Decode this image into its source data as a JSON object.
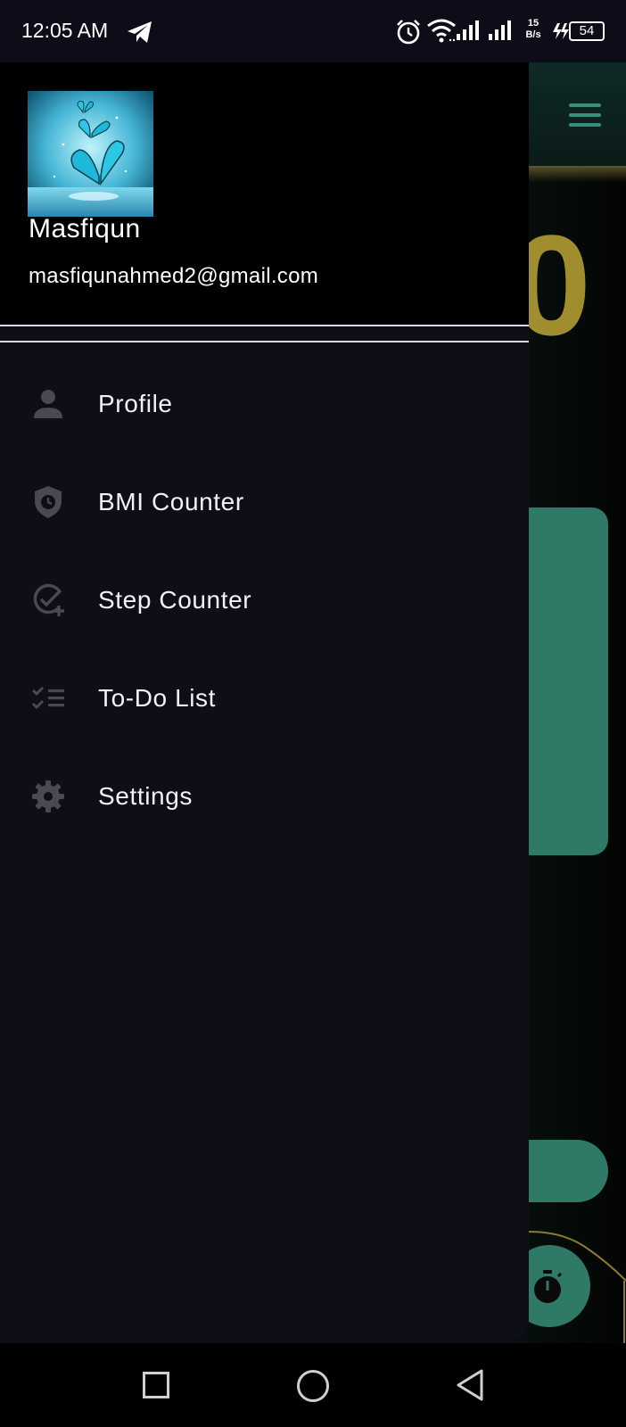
{
  "status_bar": {
    "time": "12:05 AM",
    "net_speed_value": "15",
    "net_speed_unit": "B/s",
    "battery_level": "54",
    "icons": [
      "telegram-icon",
      "alarm-icon",
      "wifi-icon",
      "signal-icon",
      "signal-icon",
      "charging-icon",
      "battery-icon"
    ]
  },
  "background_app": {
    "big_number": "0",
    "icons": [
      "menu-icon",
      "timer-icon"
    ],
    "colors": {
      "accent": "#2f7a66",
      "number": "#a08d2e"
    }
  },
  "drawer": {
    "user": {
      "name": "Masfiqun",
      "email": "masfiqunahmed2@gmail.com",
      "avatar": "butterfly-avatar"
    },
    "items": [
      {
        "label": "Profile",
        "icon": "person-icon"
      },
      {
        "label": "BMI Counter",
        "icon": "shield-clock-icon"
      },
      {
        "label": "Step Counter",
        "icon": "check-plus-icon"
      },
      {
        "label": "To-Do List",
        "icon": "checklist-icon"
      },
      {
        "label": "Settings",
        "icon": "gear-icon"
      }
    ],
    "colors": {
      "background": "#0f0d18",
      "header": "#000000",
      "icon": "#4a4853",
      "text": "#f2f0f8"
    }
  },
  "nav_bar": {
    "buttons": [
      "recent-apps-button",
      "home-button",
      "back-button"
    ]
  }
}
